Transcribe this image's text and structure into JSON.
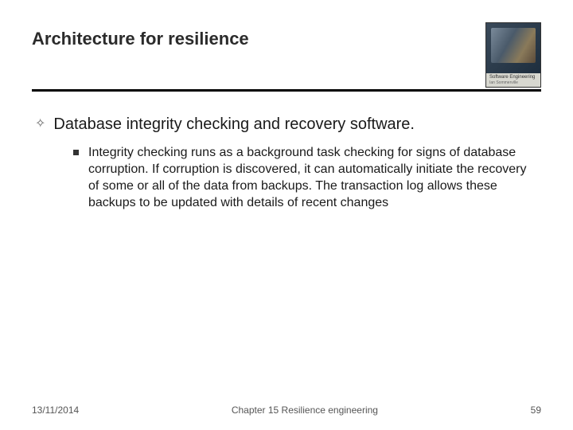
{
  "slide": {
    "title": "Architecture for resilience",
    "book": {
      "line1": "Software Engineering",
      "line2": "Ian Sommerville"
    },
    "main_point": "Database integrity checking and recovery software.",
    "sub_point": "Integrity checking runs as a background task checking for signs of database corruption. If corruption is discovered, it can automatically initiate the recovery of some or all of the data from backups. The transaction log allows these backups to be updated with details of recent changes"
  },
  "footer": {
    "date": "13/11/2014",
    "chapter": "Chapter 15 Resilience engineering",
    "page": "59"
  }
}
